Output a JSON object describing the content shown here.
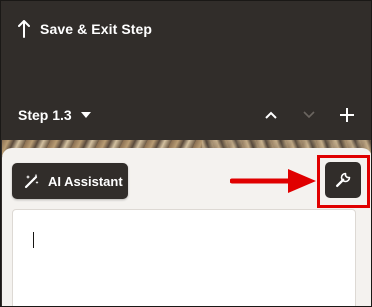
{
  "header": {
    "save_exit_label": "Save & Exit Step",
    "up_arrow_icon": "arrow-up-icon"
  },
  "step_bar": {
    "step_label": "Step 1.3",
    "caret_icon": "chevron-down-icon",
    "actions": {
      "move_up_icon": "chevron-up-icon",
      "move_down_icon": "chevron-down-icon",
      "add_icon": "plus-icon"
    }
  },
  "toolbar": {
    "ai_assistant_label": "AI Assistant",
    "ai_assistant_icon": "magic-wand-icon",
    "wrench_icon": "wrench-icon"
  },
  "editor": {
    "value": ""
  },
  "annotation": {
    "color": "#e00000",
    "arrow_icon": "arrow-right-icon"
  },
  "colors": {
    "background": "#312d2a",
    "panel": "#f4f2ef",
    "button": "#312d2a",
    "highlight": "#e00000"
  }
}
